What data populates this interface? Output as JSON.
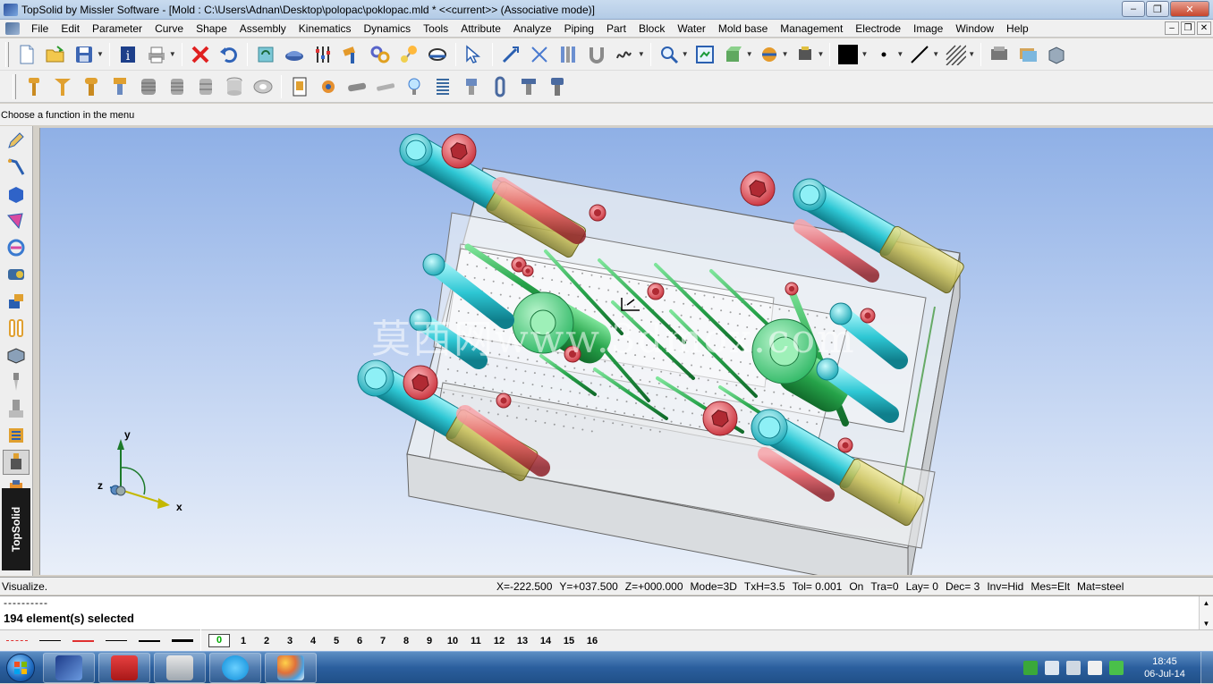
{
  "window": {
    "title": "TopSolid by Missler Software - [Mold : C:\\Users\\Adnan\\Desktop\\polopac\\poklopac.mld *  <<current>> (Associative mode)]",
    "minimize": "–",
    "maximize": "❐",
    "close": "✕"
  },
  "menu": {
    "items": [
      "File",
      "Edit",
      "Parameter",
      "Curve",
      "Shape",
      "Assembly",
      "Kinematics",
      "Dynamics",
      "Tools",
      "Attribute",
      "Analyze",
      "Piping",
      "Part",
      "Block",
      "Water",
      "Mold base",
      "Management",
      "Electrode",
      "Image",
      "Window",
      "Help"
    ],
    "doc_min": "–",
    "doc_restore": "❐",
    "doc_close": "✕"
  },
  "toolbar1": {
    "icons": [
      "new-file-icon",
      "open-folder-icon",
      "save-icon",
      "info-icon",
      "print-icon",
      "delete-icon",
      "undo-icon",
      "refresh-icon",
      "cap-icon",
      "sliders-icon",
      "hammer-icon",
      "links-icon",
      "balloon-icon",
      "eye-icon",
      "pointer-icon",
      "edit-arrow-icon",
      "cut-icon",
      "columns-icon",
      "magnet-icon",
      "signature-icon",
      "zoom-icon",
      "fit-icon",
      "view-icon",
      "render-icon",
      "printer-3d-icon",
      "color-swatch-icon",
      "point-style-icon",
      "line-style-icon",
      "hatch-icon",
      "layer-icon",
      "layers-icon",
      "box-icon"
    ],
    "color_swatch": "#000000"
  },
  "toolbar2": {
    "icons": [
      "screw-1-icon",
      "screw-2-icon",
      "screw-3-icon",
      "screw-4-icon",
      "screw-5-icon",
      "screw-6-icon",
      "screw-7-icon",
      "bushing-icon",
      "ring-icon",
      "doc-component-icon",
      "gear-icon",
      "tube-icon",
      "pin-icon",
      "bulb-icon",
      "spring-icon",
      "cylinder-icon",
      "link-icon",
      "clamp-icon",
      "bolt-icon"
    ]
  },
  "hint": "Choose a function in the menu",
  "left_toolbar": {
    "icons": [
      "pencil-icon",
      "curve-icon",
      "solid-icon",
      "shape-icon",
      "assembly-icon",
      "kinematics-icon",
      "part-icon",
      "mold-icon",
      "block-icon",
      "punch-icon",
      "ejector-icon",
      "cooling-icon",
      "component-icon",
      "electrode-icon"
    ],
    "vertical_label": "TopSolid"
  },
  "viewport": {
    "watermark": "莫西网www.3dmox.com",
    "axis_labels": {
      "y": "y",
      "z": "z",
      "x": "x"
    },
    "colors": {
      "plate": "#d9dcdf",
      "guide": "#2ec7d4",
      "bolt": "#e1525b",
      "ejector": "#26a34a",
      "sleeve": "#c9c054"
    }
  },
  "status": {
    "action": "Visualize.",
    "fields": [
      "X=-222.500",
      "Y=+037.500",
      "Z=+000.000",
      "Mode=3D",
      "TxH=3.5",
      "Tol= 0.001",
      "On",
      "Tra=0",
      "Lay= 0",
      "Dec= 3",
      "Inv=Hid",
      "Mes=Elt",
      "Mat=steel"
    ]
  },
  "message": {
    "line1": "----------",
    "line2": "194 element(s) selected"
  },
  "layers": {
    "current": "0",
    "numbers": [
      "1",
      "2",
      "3",
      "4",
      "5",
      "6",
      "7",
      "8",
      "9",
      "10",
      "11",
      "12",
      "13",
      "14",
      "15",
      "16"
    ]
  },
  "taskbar": {
    "apps": [
      "topsolid-icon",
      "solidworks-icon",
      "calculator-icon",
      "skype-icon",
      "paint-icon"
    ],
    "clock_time": "18:45",
    "clock_date": "06-Jul-14"
  }
}
